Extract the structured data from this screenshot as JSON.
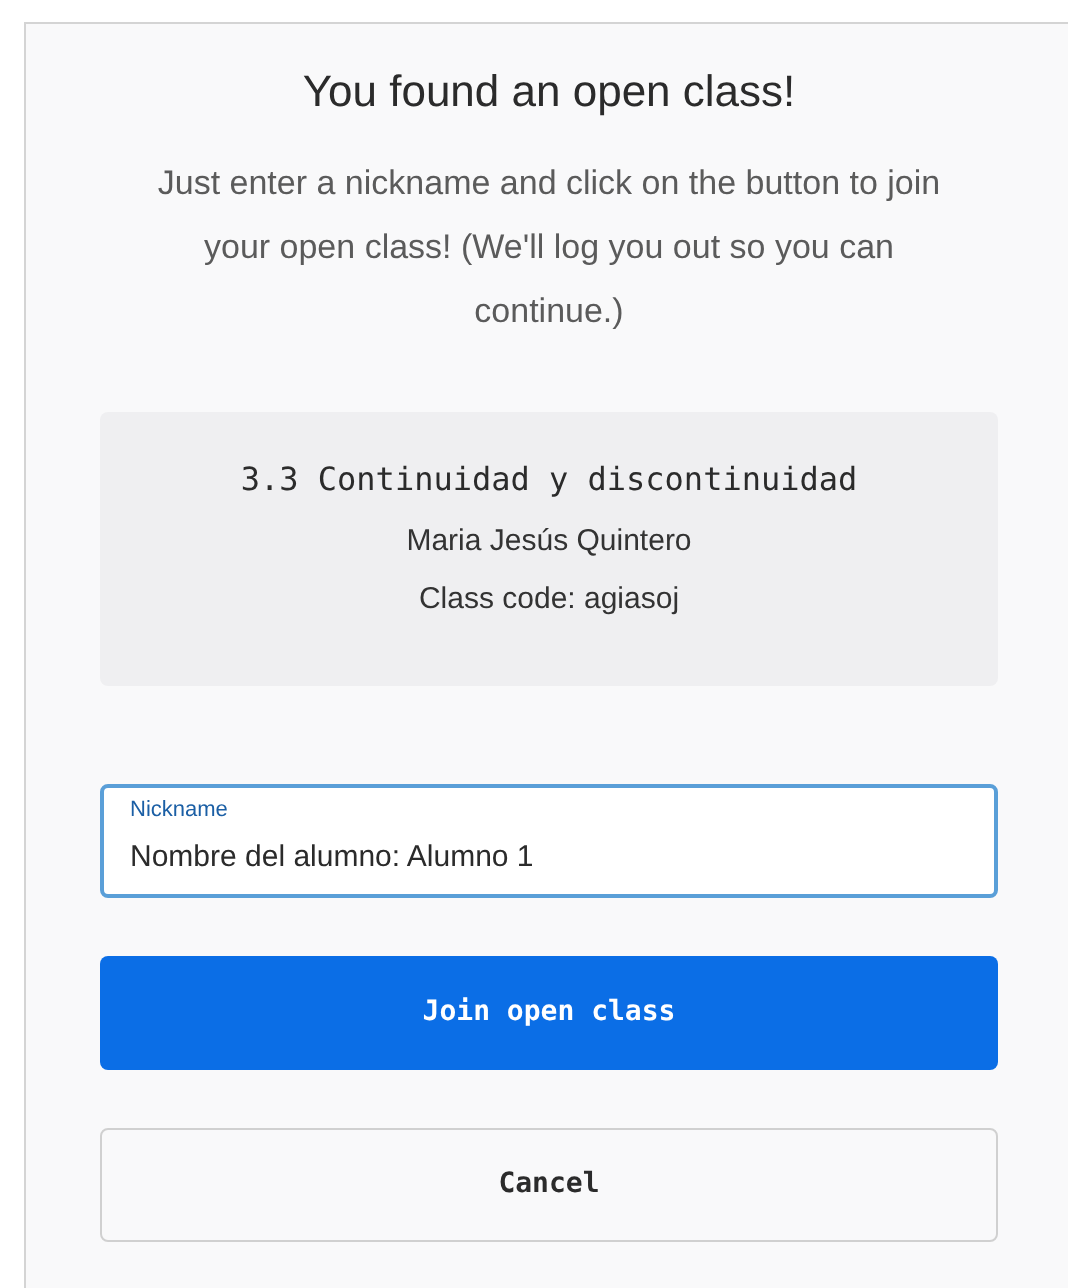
{
  "dialog": {
    "title": "You found an open class!",
    "message": "Just enter a nickname and click on the button to join your open class! (We'll log you out so you can continue.)"
  },
  "class_info": {
    "name": "3.3 Continuidad y discontinuidad",
    "teacher": "Maria Jesús Quintero",
    "code": "Class code: agiasoj"
  },
  "nickname_field": {
    "label": "Nickname",
    "value": "Nombre del alumno: Alumno 1",
    "focused": true
  },
  "buttons": [
    {
      "label": "Join open class",
      "kind": "primary"
    },
    {
      "label": "Cancel",
      "kind": "secondary"
    }
  ]
}
